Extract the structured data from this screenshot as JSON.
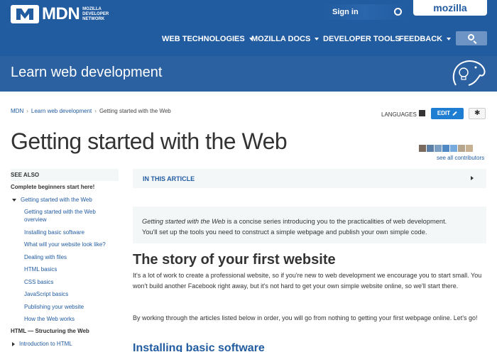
{
  "header": {
    "logo_text": "MDN",
    "logo_sub": "MOZILLA DEVELOPER NETWORK",
    "signin_label": "Sign in",
    "mozilla_label": "mozilla",
    "nav": [
      {
        "label": "WEB TECHNOLOGIES",
        "has_caret": true
      },
      {
        "label": "MOZILLA DOCS",
        "has_caret": true
      },
      {
        "label": "DEVELOPER TOOLS",
        "has_caret": false
      },
      {
        "label": "FEEDBACK",
        "has_caret": true
      }
    ],
    "search_icon": "search-icon"
  },
  "banner": {
    "title": "Learn web development"
  },
  "breadcrumb": {
    "items": [
      "MDN",
      "Learn web development",
      "Getting started with the Web"
    ]
  },
  "toolbar": {
    "languages_label": "LANGUAGES",
    "edit_label": "EDIT",
    "gear_icon": "gear-icon"
  },
  "page": {
    "title": "Getting started with the Web",
    "see_contributors": "see all contributors"
  },
  "sidebar": {
    "heading": "SEE ALSO",
    "items": [
      {
        "label": "Complete beginners start here!",
        "level": 0,
        "style": "bold"
      },
      {
        "label": "Getting started with the Web",
        "level": 1,
        "style": "open"
      },
      {
        "label": "Getting started with the Web",
        "level": 2
      },
      {
        "label": "overview",
        "level": 2
      },
      {
        "label": "Installing basic software",
        "level": 2
      },
      {
        "label": "What will your website look like?",
        "level": 2
      },
      {
        "label": "Dealing with files",
        "level": 2
      },
      {
        "label": "HTML basics",
        "level": 2
      },
      {
        "label": "CSS basics",
        "level": 2
      },
      {
        "label": "JavaScript basics",
        "level": 2
      },
      {
        "label": "Publishing your website",
        "level": 2
      },
      {
        "label": "How the Web works",
        "level": 2
      },
      {
        "label": "HTML — Structuring the Web",
        "level": 0,
        "style": "bold"
      },
      {
        "label": "Introduction to HTML",
        "level": 1,
        "style": "closed"
      }
    ]
  },
  "article": {
    "toc_label": "IN THIS ARTICLE",
    "intro_italic": "Getting started with the Web",
    "intro_rest_line1": " is a concise series introducing you to the practicalities of web development.",
    "intro_line2": "You'll set up the tools you need to construct a simple webpage and publish your own simple code.",
    "h2": "The story of your first website",
    "para1": "It's a lot of work to create a professional website, so if you're new to web development we encourage you to start small. You won't build another Facebook right away, but it's not hard to get your own simple website online, so we'll start there.",
    "para2": "By working through the articles listed below in order, you will go from nothing to getting your first webpage online. Let's go!",
    "h3": "Installing basic software"
  },
  "colors": {
    "header_bg": "#215ba0",
    "banner_bg": "#2b60a1",
    "link": "#215ba0",
    "edit_button": "#1f7ed2",
    "panel_bg": "#f4f7f8"
  }
}
